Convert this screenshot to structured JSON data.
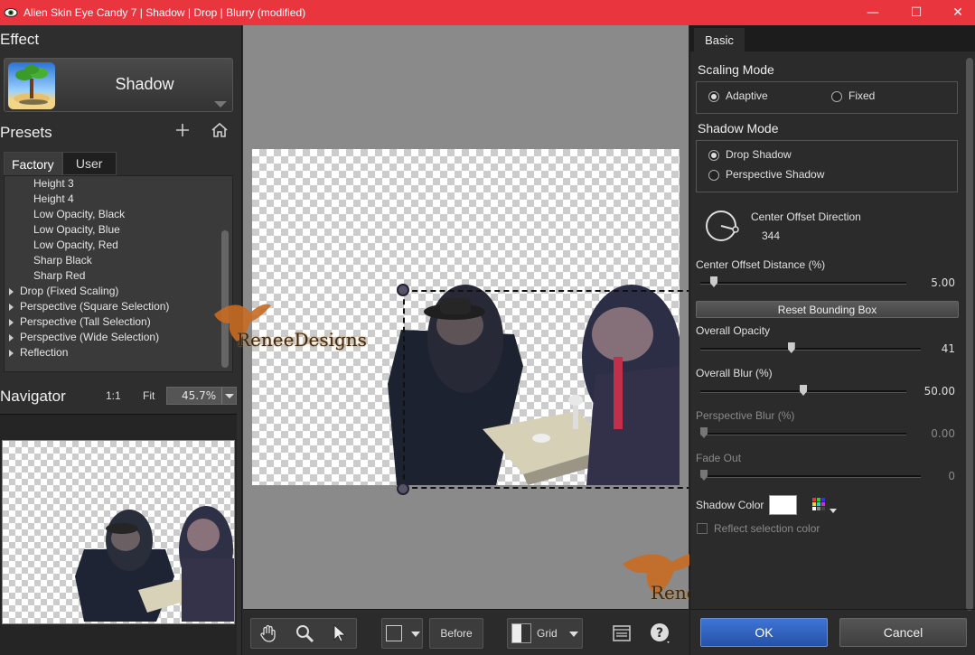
{
  "window": {
    "title": "Alien Skin Eye Candy 7 | Shadow | Drop | Blurry (modified)",
    "minimize": "—",
    "maximize": "☐",
    "close": "✕",
    "accent_color": "#e8353e"
  },
  "effect": {
    "section_title": "Effect",
    "name": "Shadow"
  },
  "presets": {
    "section_title": "Presets",
    "tabs": [
      {
        "label": "Factory",
        "active": true
      },
      {
        "label": "User",
        "active": false
      }
    ],
    "items": [
      {
        "label": "Height 3",
        "group": false
      },
      {
        "label": "Height 4",
        "group": false
      },
      {
        "label": "Low Opacity, Black",
        "group": false
      },
      {
        "label": "Low Opacity, Blue",
        "group": false
      },
      {
        "label": "Low Opacity, Red",
        "group": false
      },
      {
        "label": "Sharp Black",
        "group": false
      },
      {
        "label": "Sharp Red",
        "group": false
      },
      {
        "label": "Drop (Fixed Scaling)",
        "group": true
      },
      {
        "label": "Perspective (Square Selection)",
        "group": true
      },
      {
        "label": "Perspective (Tall Selection)",
        "group": true
      },
      {
        "label": "Perspective (Wide Selection)",
        "group": true
      },
      {
        "label": "Reflection",
        "group": true
      }
    ]
  },
  "navigator": {
    "section_title": "Navigator",
    "zoom_1to1": "1:1",
    "fit": "Fit",
    "zoom_value": "45.7%"
  },
  "toolbar": {
    "before_label": "Before",
    "grid_label": "Grid"
  },
  "watermark": {
    "text": "ReneeDesigns"
  },
  "settings": {
    "tab_label": "Basic",
    "scaling_mode": {
      "title": "Scaling Mode",
      "options": [
        {
          "label": "Adaptive",
          "checked": true
        },
        {
          "label": "Fixed",
          "checked": false
        }
      ]
    },
    "shadow_mode": {
      "title": "Shadow Mode",
      "options": [
        {
          "label": "Drop Shadow",
          "checked": true
        },
        {
          "label": "Perspective Shadow",
          "checked": false
        }
      ]
    },
    "direction": {
      "label": "Center Offset Direction",
      "value": "344"
    },
    "sliders": [
      {
        "label": "Center Offset Distance (%)",
        "value": "5.00",
        "fraction": 0.05,
        "enabled": true
      },
      {
        "label": "Overall Opacity",
        "value": "41",
        "fraction": 0.41,
        "enabled": true
      },
      {
        "label": "Overall Blur (%)",
        "value": "50.00",
        "fraction": 0.5,
        "enabled": true
      },
      {
        "label": "Perspective Blur (%)",
        "value": "0.00",
        "fraction": 0.0,
        "enabled": false
      },
      {
        "label": "Fade Out",
        "value": "0",
        "fraction": 0.0,
        "enabled": false
      }
    ],
    "reset_button": "Reset Bounding Box",
    "shadow_color_label": "Shadow Color",
    "shadow_color": "#ffffff",
    "reflect_label": "Reflect selection color"
  },
  "buttons": {
    "ok": "OK",
    "cancel": "Cancel",
    "ok_color": "#2f63c4"
  }
}
